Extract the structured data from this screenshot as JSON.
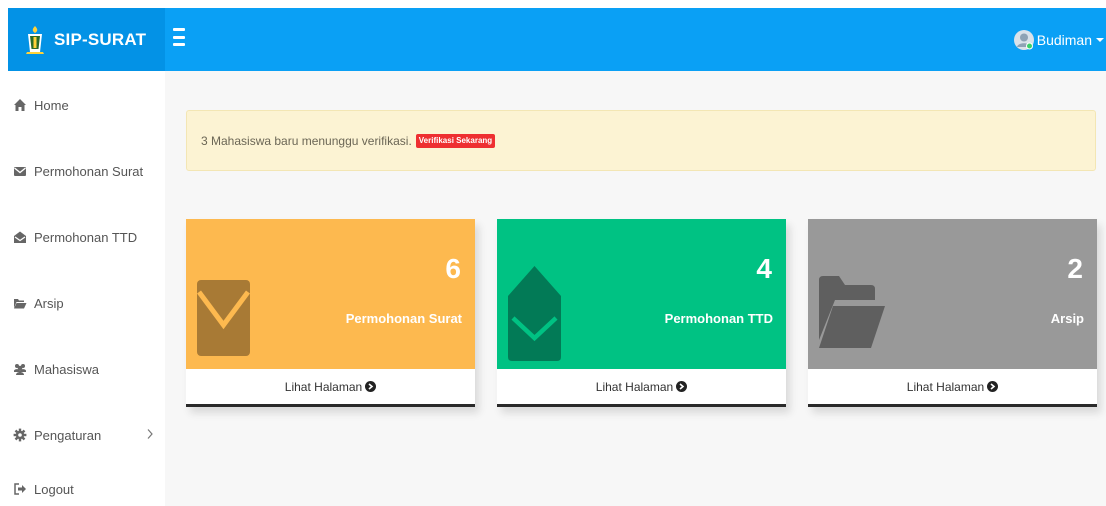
{
  "brand": {
    "name": "SIP-SURAT"
  },
  "user": {
    "name": "Budiman"
  },
  "sidebar": {
    "items": [
      {
        "label": "Home",
        "icon": "home-icon"
      },
      {
        "label": "Permohonan Surat",
        "icon": "envelope-icon"
      },
      {
        "label": "Permohonan TTD",
        "icon": "envelope-open-icon"
      },
      {
        "label": "Arsip",
        "icon": "folder-open-icon"
      },
      {
        "label": "Mahasiswa",
        "icon": "users-icon"
      },
      {
        "label": "Pengaturan",
        "icon": "gear-icon"
      },
      {
        "label": "Logout",
        "icon": "sign-out-icon"
      }
    ]
  },
  "alert": {
    "text": "3 Mahasiswa baru menunggu verifikasi.",
    "button": "Verifikasi Sekarang"
  },
  "cards": [
    {
      "count": "6",
      "label": "Permohonan Surat",
      "footer": "Lihat Halaman",
      "color": "#fdb94f",
      "icon": "envelope-icon"
    },
    {
      "count": "4",
      "label": "Permohonan TTD",
      "footer": "Lihat Halaman",
      "color": "#00c283",
      "icon": "envelope-open-icon"
    },
    {
      "count": "2",
      "label": "Arsip",
      "footer": "Lihat Halaman",
      "color": "#999999",
      "icon": "folder-open-icon"
    }
  ],
  "colors": {
    "topbar": "#0aa0f5",
    "brand_bg": "#0392e6",
    "alert_bg": "#fcf3d3",
    "alert_button": "#ee2f31"
  }
}
